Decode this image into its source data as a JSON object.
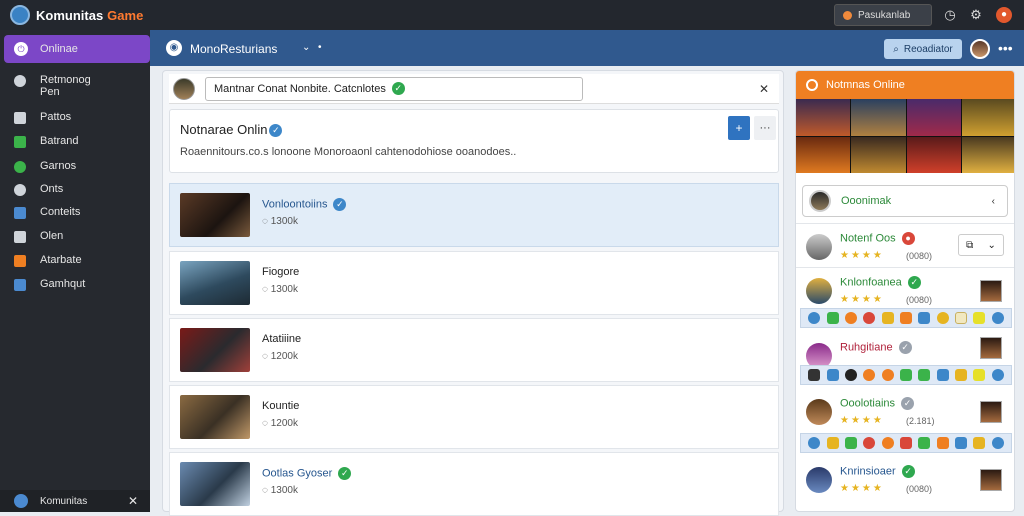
{
  "app": {
    "name_a": "Komunitas",
    "name_b": "Game"
  },
  "topbar": {
    "search_label": "Pasukanlab"
  },
  "sidebar": {
    "active": "Onlinae",
    "items": [
      {
        "label": "Retmonog",
        "sub": "Pen",
        "color": "#cfd4da",
        "icon": "globe-icon"
      },
      {
        "label": "Pattos",
        "color": "#cfd4da",
        "icon": "pin-icon"
      },
      {
        "label": "Batrand",
        "color": "#3bb34a",
        "icon": "chat-icon"
      },
      {
        "label": "Garnos",
        "color": "#3bb34a",
        "icon": "gamepad-icon"
      },
      {
        "label": "Onts",
        "color": "#cfd4da",
        "icon": "share-icon"
      },
      {
        "label": "Conteits",
        "color": "#4b8ad0",
        "icon": "grid-icon"
      },
      {
        "label": "Olen",
        "color": "#cfd4da",
        "icon": "calendar-icon"
      },
      {
        "label": "Atarbate",
        "color": "#ef7f22",
        "icon": "rss-icon"
      },
      {
        "label": "Gamhqut",
        "color": "#4b8ad0",
        "icon": "app-icon"
      }
    ],
    "footer": "Komunitas"
  },
  "mainhead": {
    "title": "MonoResturians",
    "button": "Reoadiator"
  },
  "composer": {
    "text": "Mantnar Conat Nonbite. Catcnlotes"
  },
  "info": {
    "title": "Notnarae Onlin",
    "desc": "Roaennitours.co.s lonoone Monoroaonl cahtenodohiose ooanodoes.."
  },
  "games": [
    {
      "name": "Vonloontoiins",
      "stat": "1300k",
      "verified": "blue",
      "selected": true
    },
    {
      "name": "Fiogore",
      "stat": "1300k",
      "verified": "",
      "selected": false
    },
    {
      "name": "Atatiiine",
      "stat": "1200k",
      "verified": "",
      "selected": false
    },
    {
      "name": "Kountie",
      "stat": "1200k",
      "verified": "",
      "selected": false
    },
    {
      "name": "Ootlas Gyoser",
      "stat": "1300k",
      "verified": "green",
      "selected": false
    }
  ],
  "right": {
    "header": "Notmnas Online",
    "search": "Ooonimak",
    "members": [
      {
        "name": "Notenf Oos",
        "count": "(0080)",
        "badge": "red",
        "color": "#2d8a3a"
      },
      {
        "name": "Knlonfoanea",
        "count": "(0080)",
        "badge": "green",
        "color": "#2d8a3a"
      },
      {
        "name": "Ruhgitiane",
        "count": "",
        "badge": "grey",
        "color": "#b0213a"
      },
      {
        "name": "Ooolotiains",
        "count": "(2.181)",
        "badge": "grey",
        "color": "#2d8a3a"
      },
      {
        "name": "Knrinsioaer",
        "count": "(0080)",
        "badge": "green",
        "color": "#27578f"
      }
    ]
  }
}
